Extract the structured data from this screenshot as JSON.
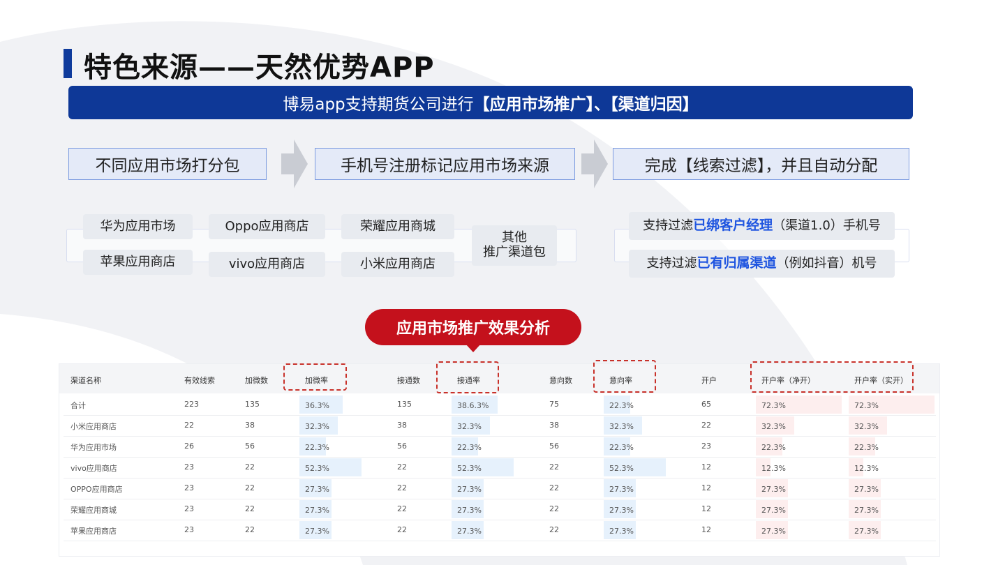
{
  "page": {
    "title": "特色来源——天然优势APP",
    "banner_prefix": "博易app支持期货公司进行",
    "banner_bold": "【应用市场推广】、【渠道归因】"
  },
  "flow": [
    {
      "label": "不同应用市场打分包"
    },
    {
      "label": "手机号注册标记应用市场来源"
    },
    {
      "label": "完成【线索过滤】，并且自动分配"
    }
  ],
  "markets": {
    "huawei": "华为应用市场",
    "oppo": "Oppo应用商店",
    "honor": "荣耀应用商城",
    "apple": "苹果应用商店",
    "vivo": "vivo应用商店",
    "xiaomi": "小米应用商店",
    "other_line1": "其他",
    "other_line2": "推广渠道包"
  },
  "filters": [
    {
      "prefix": "支持过滤",
      "highlight": "已绑客户经理",
      "suffix": "（渠道1.0）手机号"
    },
    {
      "prefix": "支持过滤",
      "highlight": "已有归属渠道",
      "suffix": "（例如抖音）机号"
    }
  ],
  "analysis_label": "应用市场推广效果分析",
  "colors": {
    "brand_blue": "#0e3897",
    "accent_red": "#c4111c",
    "highlight_blue": "#1f55e0"
  },
  "table": {
    "headers": [
      "渠道名称",
      "有效线索",
      "加微数",
      "加微率",
      "接通数",
      "接通率",
      "意向数",
      "意向率",
      "开户",
      "开户率（净开）",
      "开户率（实开）"
    ],
    "rows": [
      [
        "合计",
        "223",
        "135",
        "36.3%",
        "135",
        "38.6.3%",
        "75",
        "22.3%",
        "65",
        "72.3%",
        "72.3%"
      ],
      [
        "小米应用商店",
        "22",
        "38",
        "32.3%",
        "38",
        "32.3%",
        "38",
        "32.3%",
        "22",
        "32.3%",
        "32.3%"
      ],
      [
        "华为应用市场",
        "26",
        "56",
        "22.3%",
        "56",
        "22.3%",
        "56",
        "22.3%",
        "23",
        "22.3%",
        "22.3%"
      ],
      [
        "vivo应用商店",
        "23",
        "22",
        "52.3%",
        "22",
        "52.3%",
        "22",
        "52.3%",
        "12",
        "12.3%",
        "12.3%"
      ],
      [
        "OPPO应用商店",
        "23",
        "22",
        "27.3%",
        "22",
        "27.3%",
        "22",
        "27.3%",
        "12",
        "27.3%",
        "27.3%"
      ],
      [
        "荣耀应用商城",
        "23",
        "22",
        "27.3%",
        "22",
        "27.3%",
        "22",
        "27.3%",
        "12",
        "27.3%",
        "27.3%"
      ],
      [
        "苹果应用商店",
        "23",
        "22",
        "27.3%",
        "22",
        "27.3%",
        "22",
        "27.3%",
        "12",
        "27.3%",
        "27.3%"
      ]
    ],
    "highlighted_columns": [
      "加微率",
      "接通率",
      "意向率",
      "开户率（净开）",
      "开户率（实开）"
    ]
  }
}
